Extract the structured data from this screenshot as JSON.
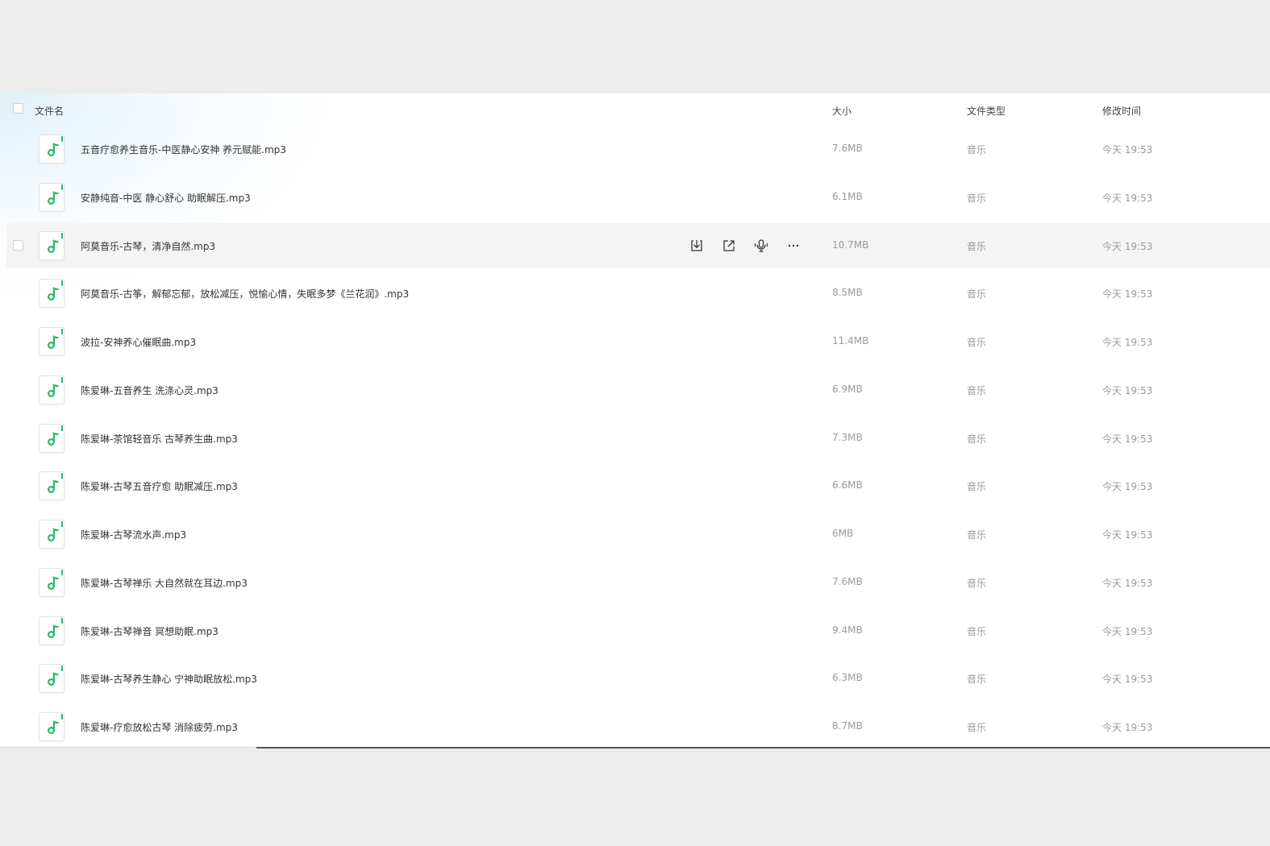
{
  "header": {
    "name": "文件名",
    "size": "大小",
    "type": "文件类型",
    "time": "修改时间"
  },
  "accent_color": "#2fb66a",
  "hover_row_index": 2,
  "row_actions": [
    {
      "icon": "download-icon"
    },
    {
      "icon": "share-icon"
    },
    {
      "icon": "audio-play-icon"
    },
    {
      "icon": "more-icon"
    }
  ],
  "files": [
    {
      "name": "五音疗愈养生音乐-中医静心安神 养元赋能.mp3",
      "size": "7.6MB",
      "type": "音乐",
      "time": "今天 19:53"
    },
    {
      "name": "安静纯音-中医 静心舒心 助眠解压.mp3",
      "size": "6.1MB",
      "type": "音乐",
      "time": "今天 19:53"
    },
    {
      "name": "阿莫音乐-古琴，清净自然.mp3",
      "size": "10.7MB",
      "type": "音乐",
      "time": "今天 19:53"
    },
    {
      "name": "阿莫音乐-古筝，解郁忘郁，放松减压，悦愉心情，失眠多梦《兰花润》.mp3",
      "size": "8.5MB",
      "type": "音乐",
      "time": "今天 19:53"
    },
    {
      "name": "波拉-安神养心催眠曲.mp3",
      "size": "11.4MB",
      "type": "音乐",
      "time": "今天 19:53"
    },
    {
      "name": "陈爱琳-五音养生 洗涤心灵.mp3",
      "size": "6.9MB",
      "type": "音乐",
      "time": "今天 19:53"
    },
    {
      "name": "陈爱琳-茶馆轻音乐 古琴养生曲.mp3",
      "size": "7.3MB",
      "type": "音乐",
      "time": "今天 19:53"
    },
    {
      "name": "陈爱琳-古琴五音疗愈 助眠减压.mp3",
      "size": "6.6MB",
      "type": "音乐",
      "time": "今天 19:53"
    },
    {
      "name": "陈爱琳-古琴流水声.mp3",
      "size": "6MB",
      "type": "音乐",
      "time": "今天 19:53"
    },
    {
      "name": "陈爱琳-古琴禅乐 大自然就在耳边.mp3",
      "size": "7.6MB",
      "type": "音乐",
      "time": "今天 19:53"
    },
    {
      "name": "陈爱琳-古琴禅音 冥想助眠.mp3",
      "size": "9.4MB",
      "type": "音乐",
      "time": "今天 19:53"
    },
    {
      "name": "陈爱琳-古琴养生静心 宁神助眠放松.mp3",
      "size": "6.3MB",
      "type": "音乐",
      "time": "今天 19:53"
    },
    {
      "name": "陈爱琳-疗愈放松古琴 消除疲劳.mp3",
      "size": "8.7MB",
      "type": "音乐",
      "time": "今天 19:53"
    }
  ]
}
